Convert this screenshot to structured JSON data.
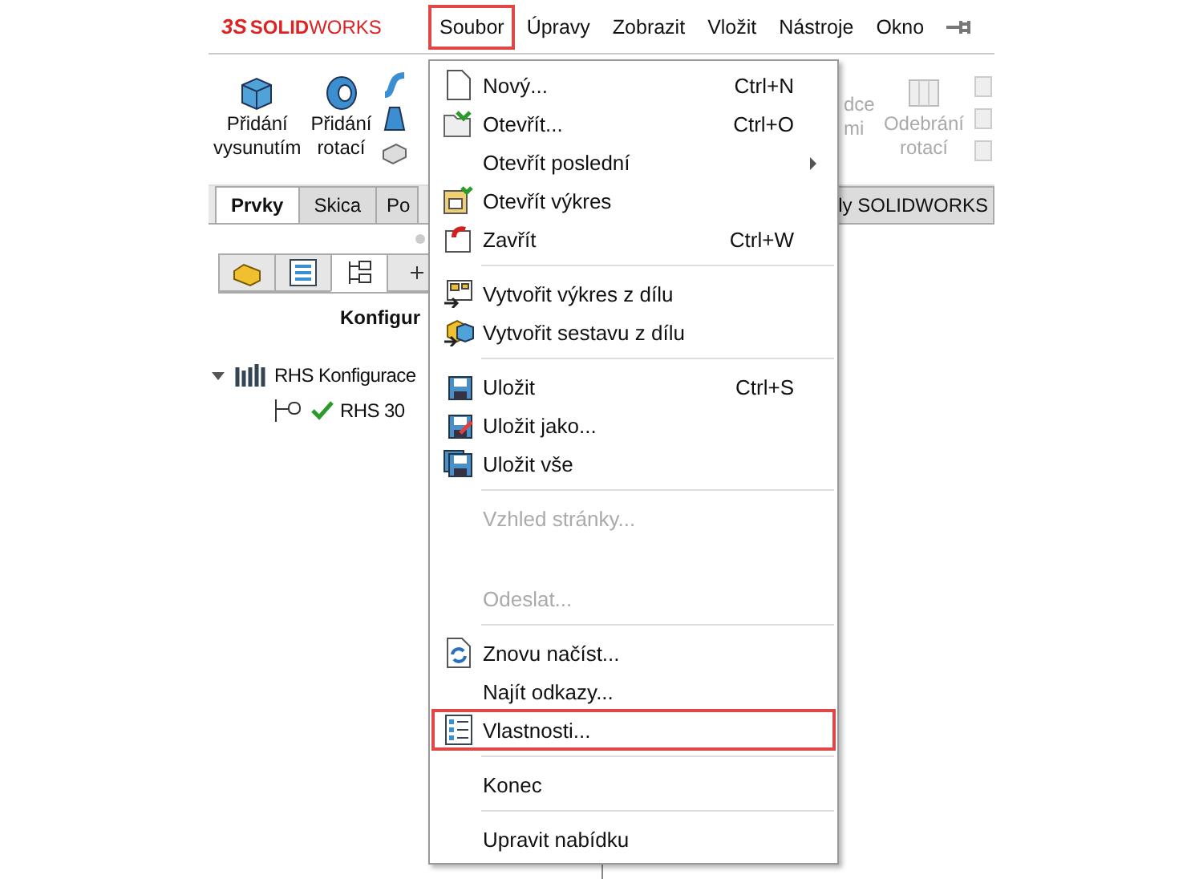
{
  "app": {
    "logo": {
      "mark": "3S",
      "text_bold": "SOLID",
      "text_light": "WORKS"
    },
    "menubar": [
      {
        "label": "Soubor",
        "selected": true
      },
      {
        "label": "Úpravy",
        "selected": false
      },
      {
        "label": "Zobrazit",
        "selected": false
      },
      {
        "label": "Vložit",
        "selected": false
      },
      {
        "label": "Nástroje",
        "selected": false
      },
      {
        "label": "Okno",
        "selected": false
      }
    ],
    "ribbon": {
      "buttons": [
        {
          "lines": [
            "Přidání",
            "vysunutím"
          ],
          "disabled": false
        },
        {
          "lines": [
            "Přidání",
            "rotací"
          ],
          "disabled": false
        }
      ],
      "right_buttons": [
        {
          "lines": [
            "dce",
            "mi"
          ],
          "disabled": true
        },
        {
          "lines": [
            "Odebrání",
            "rotací"
          ],
          "disabled": true
        }
      ]
    },
    "tabs": [
      {
        "label": "Prvky",
        "selected": true
      },
      {
        "label": "Skica",
        "selected": false
      },
      {
        "label": "Po",
        "selected": false
      }
    ],
    "tab_right": "ly SOLIDWORKS",
    "panel": {
      "icon_tabs": [
        {
          "selected": false
        },
        {
          "selected": false
        },
        {
          "selected": true
        },
        {
          "selected": false
        }
      ],
      "heading": "Konfigur",
      "tree": [
        {
          "label": "RHS Konfigurace",
          "expanded": true,
          "children": [
            {
              "label": "RHS 30",
              "checked": true
            }
          ]
        }
      ]
    }
  },
  "file_menu": {
    "items": [
      {
        "kind": "item",
        "label": "Nový...",
        "shortcut": "Ctrl+N",
        "disabled": false,
        "selected": false
      },
      {
        "kind": "item",
        "label": "Otevřít...",
        "shortcut": "Ctrl+O",
        "disabled": false,
        "selected": false
      },
      {
        "kind": "submenu",
        "label": "Otevřít poslední",
        "disabled": false,
        "selected": false
      },
      {
        "kind": "item",
        "label": "Otevřít výkres",
        "disabled": false,
        "selected": false
      },
      {
        "kind": "item",
        "label": "Zavřít",
        "shortcut": "Ctrl+W",
        "disabled": false,
        "selected": false
      },
      {
        "kind": "separator"
      },
      {
        "kind": "item",
        "label": "Vytvořit výkres z dílu",
        "disabled": false,
        "selected": false
      },
      {
        "kind": "item",
        "label": "Vytvořit sestavu z dílu",
        "disabled": false,
        "selected": false
      },
      {
        "kind": "separator"
      },
      {
        "kind": "item",
        "label": "Uložit",
        "shortcut": "Ctrl+S",
        "disabled": false,
        "selected": false
      },
      {
        "kind": "item",
        "label": "Uložit jako...",
        "disabled": false,
        "selected": false
      },
      {
        "kind": "item",
        "label": "Uložit vše",
        "disabled": false,
        "selected": false
      },
      {
        "kind": "separator"
      },
      {
        "kind": "item",
        "label": "Vzhled stránky...",
        "disabled": true,
        "selected": false
      },
      {
        "kind": "blank"
      },
      {
        "kind": "item",
        "label": "Odeslat...",
        "disabled": true,
        "selected": false
      },
      {
        "kind": "separator"
      },
      {
        "kind": "item",
        "label": "Znovu načíst...",
        "disabled": false,
        "selected": false
      },
      {
        "kind": "item",
        "label": "Najít odkazy...",
        "disabled": false,
        "selected": false
      },
      {
        "kind": "item",
        "label": "Vlastnosti...",
        "disabled": false,
        "selected": true
      },
      {
        "kind": "separator"
      },
      {
        "kind": "item",
        "label": "Konec",
        "disabled": false,
        "selected": false
      },
      {
        "kind": "separator"
      },
      {
        "kind": "item",
        "label": "Upravit nabídku",
        "disabled": false,
        "selected": false
      }
    ]
  }
}
